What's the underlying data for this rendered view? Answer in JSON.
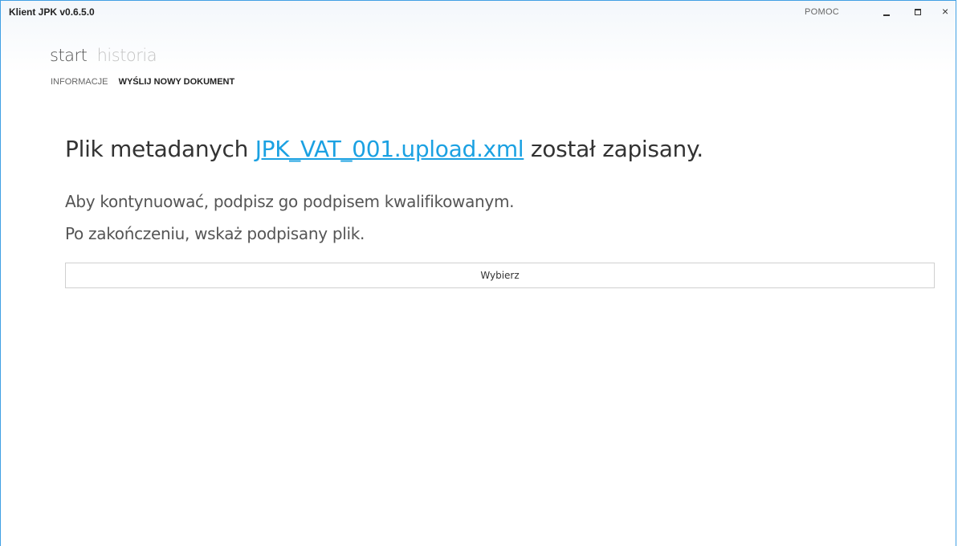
{
  "window": {
    "title": "Klient JPK v0.6.5.0",
    "help_label": "POMOC",
    "controls": {
      "minimize_icon": "minimize-icon",
      "maximize_icon": "maximize-icon",
      "close_icon": "close-icon",
      "close_glyph": "×"
    }
  },
  "main_nav": [
    {
      "label": "start",
      "active": true
    },
    {
      "label": "historia",
      "active": false
    }
  ],
  "sub_nav": [
    {
      "label": "INFORMACJE",
      "active": false
    },
    {
      "label": "WYŚLIJ NOWY DOKUMENT",
      "active": true
    }
  ],
  "content": {
    "headline_prefix": "Plik metadanych ",
    "file_link": "JPK_VAT_001.upload.xml",
    "headline_suffix": " został zapisany.",
    "instruction_line1": "Aby kontynuować, podpisz go podpisem kwalifikowanym.",
    "instruction_line2": "Po zakończeniu, wskaż podpisany plik.",
    "choose_button": "Wybierz"
  },
  "colors": {
    "accent": "#1ba1e2",
    "border": "#41a0e4"
  }
}
